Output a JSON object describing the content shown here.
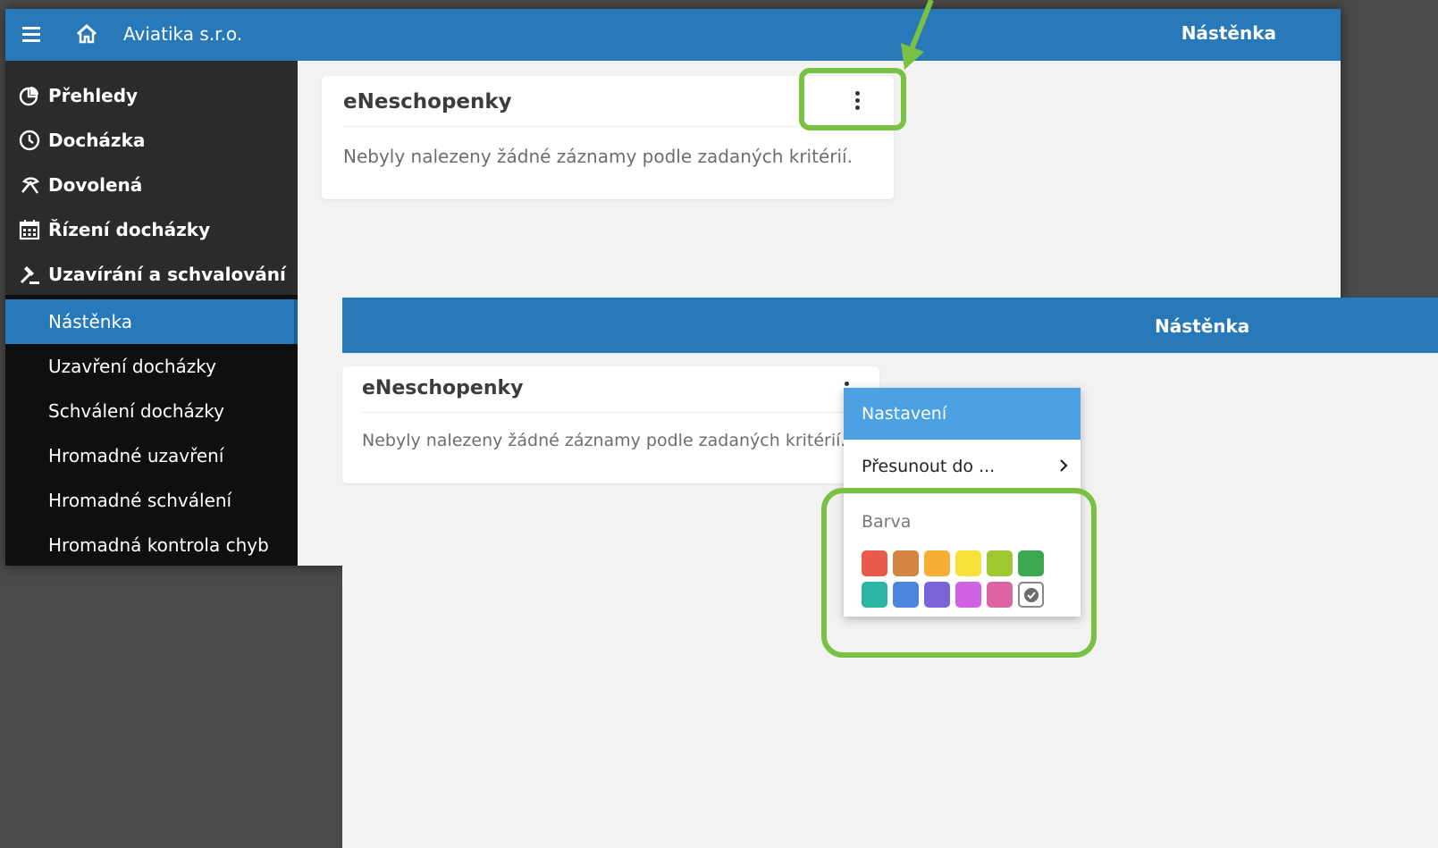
{
  "back_screen": {
    "header": {
      "company": "Aviatika s.r.o.",
      "page_title": "Nástěnka"
    },
    "sidebar": {
      "main_items": [
        {
          "label": "Přehledy",
          "icon": "pie-chart-icon"
        },
        {
          "label": "Docházka",
          "icon": "clock-icon"
        },
        {
          "label": "Dovolená",
          "icon": "umbrella-icon"
        },
        {
          "label": "Řízení docházky",
          "icon": "calendar-icon"
        },
        {
          "label": "Uzavírání a schvalování",
          "icon": "gavel-icon"
        }
      ],
      "sub_items": [
        {
          "label": "Nástěnka",
          "active": true
        },
        {
          "label": "Uzavření docházky"
        },
        {
          "label": "Schválení docházky"
        },
        {
          "label": "Hromadné uzavření"
        },
        {
          "label": "Hromadné schválení"
        },
        {
          "label": "Hromadná kontrola chyb"
        }
      ]
    },
    "card": {
      "title": "eNeschopenky",
      "message": "Nebyly nalezeny žádné záznamy podle zadaných kritérií."
    }
  },
  "front_screen": {
    "header": {
      "page_title": "Nástěnka"
    },
    "card": {
      "title": "eNeschopenky",
      "message": "Nebyly nalezeny žádné záznamy podle zadaných kritérií."
    },
    "menu": {
      "settings_label": "Nastavení",
      "move_label": "Přesunout do ...",
      "color_label": "Barva",
      "colors_row1": [
        "#e85a4a",
        "#d28642",
        "#f6ae35",
        "#f7e23a",
        "#9ec730",
        "#3aa84f"
      ],
      "colors_row2": [
        "#2bb5a2",
        "#4a86dc",
        "#7a63d8",
        "#cf63e1",
        "#dd63a3"
      ],
      "no_color_icon": "check-circle-icon"
    }
  },
  "annotation_color": "#79c142"
}
